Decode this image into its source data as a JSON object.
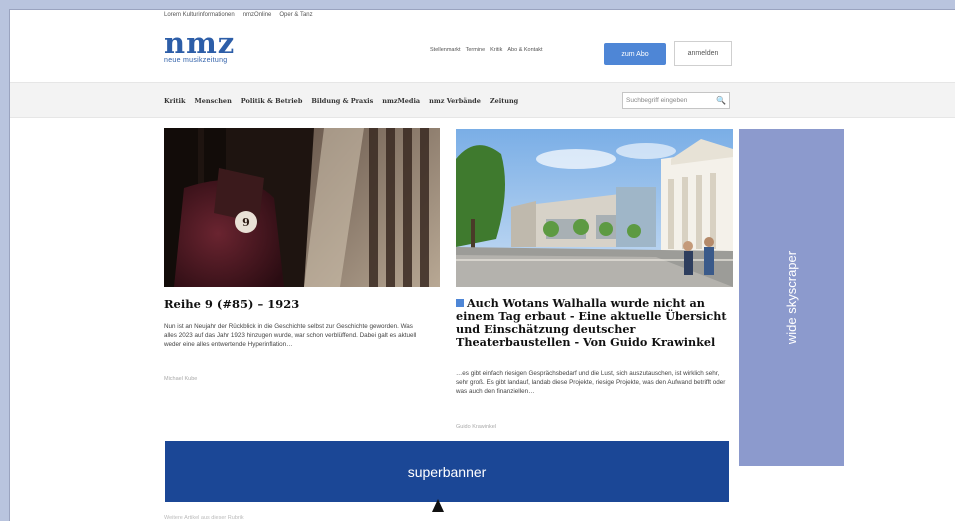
{
  "topnav": [
    "Lorem Kulturinformationen",
    "nmzOnline",
    "Oper & Tanz"
  ],
  "logo": {
    "text": "nmz",
    "subtitle": "neue musikzeitung"
  },
  "utils": [
    "Stellenmarkt",
    "Termine",
    "Kritik",
    "Abo & Kontakt"
  ],
  "buttons": {
    "abo": "zum Abo",
    "login": "anmelden"
  },
  "mainnav": [
    "Kritik",
    "Menschen",
    "Politik & Betrieb",
    "Bildung & Praxis",
    "nmzMedia",
    "nmz Verbände",
    "Zeitung"
  ],
  "search": {
    "placeholder": "Suchbegriff eingeben"
  },
  "articles": [
    {
      "title": "Reihe 9 (#85) – 1923",
      "teaser": "Nun ist an Neujahr der Rückblick in die Geschichte selbst zur Geschichte geworden. Was alles 2023 auf das Jahr 1923 hinzugen wurde, war schon verblüffend. Dabei galt es aktuell weder eine alles entwertende Hyperinflation…",
      "author": "Michael Kube",
      "seat_number": "9"
    },
    {
      "title": "Auch Wotans Walhalla wurde nicht an einem Tag erbaut - Eine aktuelle Übersicht und Einschätzung deutscher Theaterbaustellen - Von Guido Krawinkel",
      "teaser": "…es gibt einfach riesigen Gesprächsbedarf und die Lust, sich auszutauschen, ist wirklich sehr, sehr groß. Es gibt landauf, landab diese Projekte, riesige Projekte, was den Aufwand betrifft oder was auch den finanziellen…",
      "author": "Guido Krawinkel"
    }
  ],
  "ads": {
    "skyscraper": "wide skyscraper",
    "superbanner": "superbanner"
  },
  "bottom_text": "Weitere Artikel aus dieser Rubrik",
  "colors": {
    "brand": "#2d5ea8",
    "button": "#4e86d6",
    "skyscraper": "#8c9acd",
    "superbanner": "#1b4796"
  }
}
